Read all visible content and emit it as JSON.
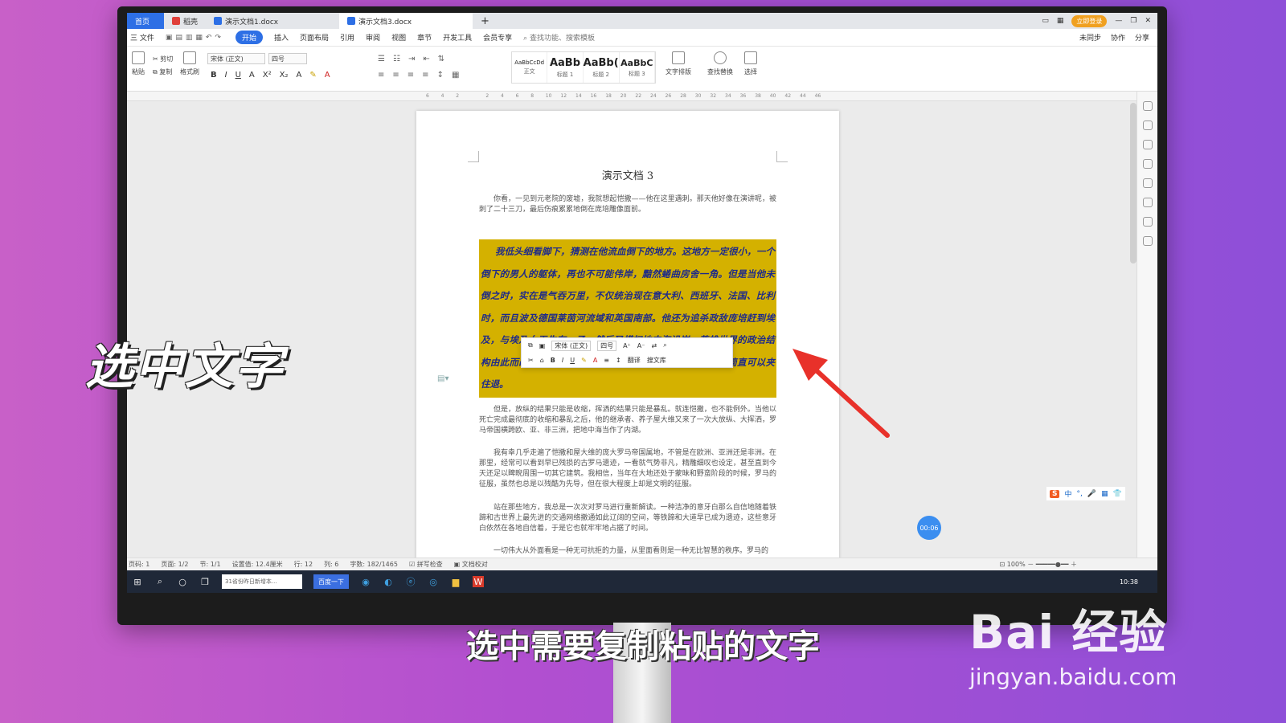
{
  "tabs": {
    "home": "首页",
    "items": [
      {
        "label": "稻壳",
        "color": "#e0403a"
      },
      {
        "label": "演示文档1.docx",
        "color": "#2d6fe5"
      },
      {
        "label": "演示文档3.docx",
        "color": "#2d6fe5"
      }
    ],
    "new_tab": "+",
    "login": "立即登录"
  },
  "menu": {
    "file": "三 文件",
    "items": [
      "开始",
      "插入",
      "页面布局",
      "引用",
      "审阅",
      "视图",
      "章节",
      "开发工具",
      "会员专享"
    ],
    "search": "查找功能、搜索模板",
    "right": [
      "未同步",
      "协作",
      "分享"
    ]
  },
  "ribbon": {
    "paste": "粘贴",
    "cut": "剪切",
    "copy": "复制",
    "format_painter": "格式刷",
    "font_name": "宋体 (正文)",
    "font_size": "四号",
    "styles": [
      {
        "sample": "AaBbCcDd",
        "name": "正文"
      },
      {
        "sample": "AaBb",
        "name": "标题 1"
      },
      {
        "sample": "AaBb(",
        "name": "标题 2"
      },
      {
        "sample": "AaBbC",
        "name": "标题 3"
      }
    ],
    "text_layout": "文字排版",
    "find_replace": "查找替换",
    "select": "选择"
  },
  "ruler": [
    "6",
    "4",
    "2",
    "",
    "2",
    "4",
    "6",
    "8",
    "10",
    "12",
    "14",
    "16",
    "18",
    "20",
    "22",
    "24",
    "26",
    "28",
    "30",
    "32",
    "34",
    "36",
    "38",
    "40",
    "42",
    "44",
    "46"
  ],
  "document": {
    "title": "演示文档 3",
    "para1": "你看，一见到元老院的废墟，我就想起恺撒——他在这里遇刺。那天他好像在演讲呢，被刺了二十三刀，最后伤痕累累地倒在庞培雕像面前。",
    "highlighted": "我低头细看脚下，猜测在他流血倒下的地方。这地方一定很小，一个倒下的男人的躯体，再也不可能伟岸，黯然蜷曲房舍一角。但是当他未倒之时，实在是气吞万里，不仅统治现在意大利、西班牙、法国、比利时，而且波及德国莱茵河流域和英国南部。他还为追杀政敌庞培赶到埃及，与埃及女王生有一子，然后又横扫地中海沿岸，英雄世界的政治结构由此而改变，大统，成为一世地所遇的英雄伟人的风采，简直可以夹住退。",
    "para2": "但是，放纵的结果只能是收缩，挥洒的结果只能是暴乱。就连恺撒，也不能例外。当他以死亡完成最彻底的收缩和暴乱之后，他的继承者、养子屋大维又来了一次大放纵、大挥洒，罗马帝国横跨欧、亚、非三洲，把地中海当作了内湖。",
    "para3": "我有幸几乎走遍了恺撒和屋大维的庞大罗马帝国属地，不管是在欧洲、亚洲还是非洲。在那里，经常可以看到早已残损的古罗马遗迹，一看就气势非凡，精雕细叹也设定，甚至直到今天还足以睥睨周围一切其它建筑。我相信，当年在大地还处于蒙昧和野蛮阶段的时候，罗马的征服，虽然也总是以残酷为先导，但在很大程度上却是文明的征服。",
    "para4": "站在那些地方，我总是一次次对罗马进行重新解读。一种洁净的意牙白那么自信地随着铁蹄和古世界上最先进的交通网络撤通如此辽阔的空间，等铁蹄和大道早已成为遗迹，这些意牙白依然在各地自信着，于是它也就牢牢地占据了时间。",
    "para5": "一切伟大从外面看是一种无可抗拒的力量，从里面看则是一种无比智慧的秩序。罗马的"
  },
  "mini_toolbar": {
    "font": "宋体 (正文)",
    "size": "四号",
    "translate": "翻译",
    "search_lib": "搜文库"
  },
  "timer": "00:06",
  "ime": [
    "中",
    "°,",
    "🎤",
    "▦",
    "👕"
  ],
  "status": {
    "page": "页码: 1",
    "pages": "页面: 1/2",
    "section": "节: 1/1",
    "position": "设置值: 12.4厘米",
    "row": "行: 12",
    "col": "列: 6",
    "words": "字数: 182/1465",
    "spell": "拼写检查",
    "proofread": "文档校对",
    "zoom": "100%"
  },
  "taskbar": {
    "search_placeholder": "31省份昨日新增本...",
    "baidu_button": "百度一下",
    "clock": "10:38"
  },
  "overlay_label": "选中文字",
  "subtitle": "选中需要复制粘贴的文字",
  "watermark": {
    "brand": "Bai 经验",
    "url": "jingyan.baidu.com"
  },
  "colors": {
    "highlight": "#d4b100",
    "highlight_text": "#1e2a8a",
    "accent_blue": "#2d6fe5",
    "arrow": "#e8312a"
  }
}
